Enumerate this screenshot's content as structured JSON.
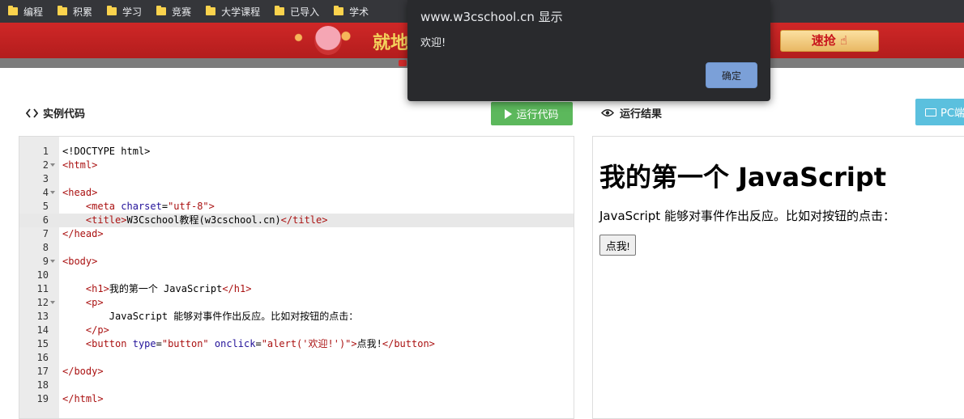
{
  "bookmarks": [
    "编程",
    "积累",
    "学习",
    "竞赛",
    "大学课程",
    "已导入",
    "学术"
  ],
  "banner": {
    "text": "就地",
    "rush_label": "速抢"
  },
  "code_panel": {
    "title": "实例代码",
    "run_label": "运行代码"
  },
  "result_panel": {
    "title": "运行结果",
    "pc_label": "PC端"
  },
  "editor": {
    "line_numbers": [
      "1",
      "2",
      "3",
      "4",
      "5",
      "6",
      "7",
      "8",
      "9",
      "10",
      "11",
      "12",
      "13",
      "14",
      "15",
      "16",
      "17",
      "18",
      "19"
    ],
    "lines": [
      "<!DOCTYPE html>",
      "<html>",
      "",
      "<head>",
      "    <meta charset=\"utf-8\">",
      "    <title>W3Cschool教程(w3cschool.cn)</title>",
      "</head>",
      "",
      "<body>",
      "",
      "    <h1>我的第一个 JavaScript</h1>",
      "    <p>",
      "        JavaScript 能够对事件作出反应。比如对按钮的点击：",
      "    </p>",
      "    <button type=\"button\" onclick=\"alert('欢迎!')\">点我!</button>",
      "",
      "</body>",
      "",
      "</html>"
    ],
    "active_line": 6
  },
  "preview": {
    "heading": "我的第一个 JavaScript",
    "paragraph": "JavaScript 能够对事件作出反应。比如对按钮的点击：",
    "button_label": "点我!"
  },
  "dialog": {
    "title": "www.w3cschool.cn 显示",
    "message": "欢迎!",
    "ok_label": "确定"
  }
}
